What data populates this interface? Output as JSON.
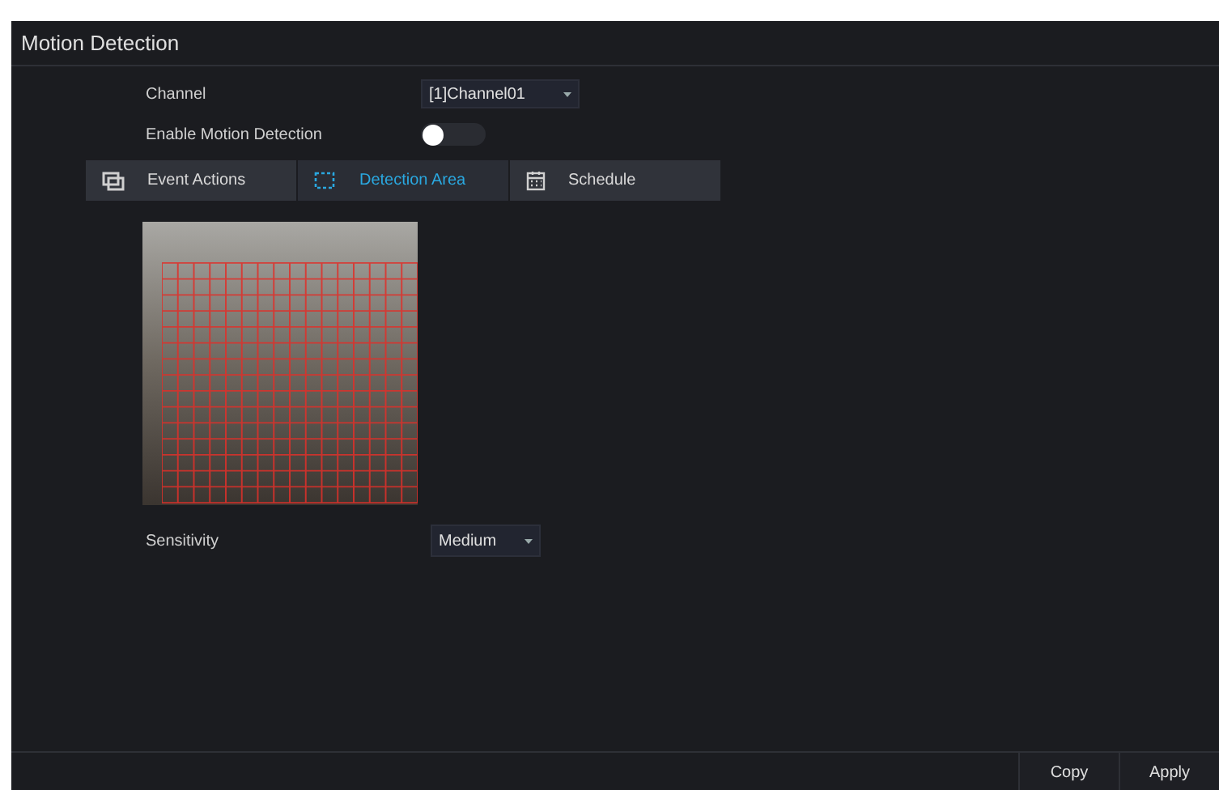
{
  "title": "Motion Detection",
  "channel": {
    "label": "Channel",
    "value": "[1]Channel01"
  },
  "enable": {
    "label": "Enable Motion Detection",
    "on": false
  },
  "tabs": [
    {
      "label": "Event Actions",
      "kind": "screens",
      "selected": false
    },
    {
      "label": "Detection Area",
      "kind": "area",
      "selected": true
    },
    {
      "label": "Schedule",
      "kind": "calendar",
      "selected": false
    }
  ],
  "sensitivity": {
    "label": "Sensitivity",
    "value": "Medium"
  },
  "buttons": [
    "Copy",
    "Apply"
  ]
}
